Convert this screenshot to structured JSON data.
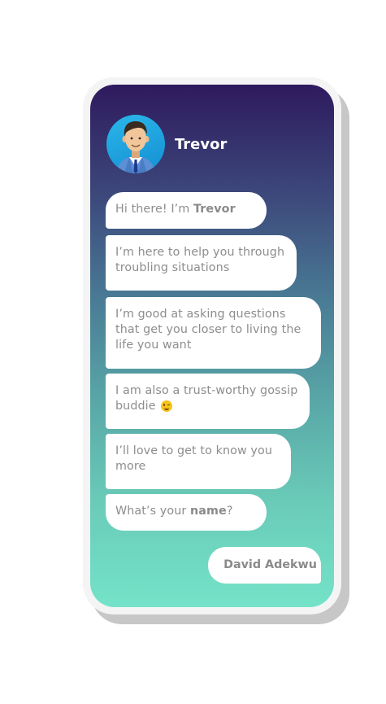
{
  "contact": {
    "name": "Trevor"
  },
  "messages": [
    {
      "pre": "Hi there! I’m ",
      "bold": "Trevor",
      "post": ""
    },
    {
      "text": "I’m here to help you through troubling situations"
    },
    {
      "text": "I’m good at asking questions that get you closer to living the life you want"
    },
    {
      "text": "I am also a trust-worthy gossip buddie",
      "emoji": "winking-face-emoji"
    },
    {
      "text": "I’ll love to get to know you more"
    },
    {
      "pre": "What’s your ",
      "bold": "name",
      "post": "?"
    }
  ],
  "reply": {
    "text": "David Adekwu"
  },
  "colors": {
    "gradient_top": "#2e1a5e",
    "gradient_bottom": "#74e3c8",
    "bubble": "#ffffff",
    "bubble_text": "#8d8d8d"
  }
}
